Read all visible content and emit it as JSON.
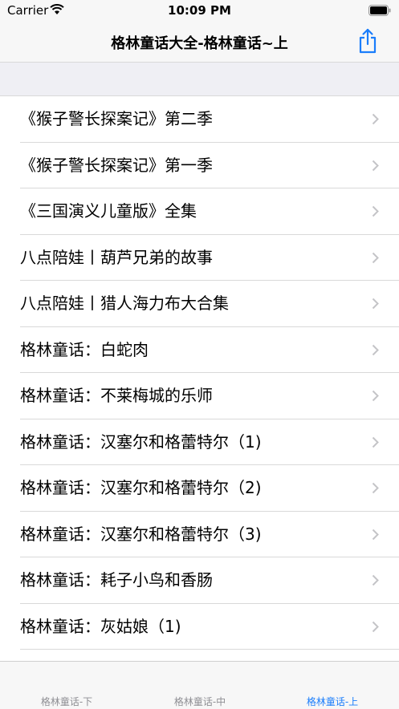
{
  "status": {
    "carrier": "Carrier",
    "time": "10:09 PM"
  },
  "nav": {
    "title": "格林童话大全-格林童话~上"
  },
  "items": [
    {
      "label": "《猴子警长探案记》第二季"
    },
    {
      "label": "《猴子警长探案记》第一季"
    },
    {
      "label": "《三国演义儿童版》全集"
    },
    {
      "label": "八点陪娃丨葫芦兄弟的故事"
    },
    {
      "label": "八点陪娃丨猎人海力布大合集"
    },
    {
      "label": "格林童话：白蛇肉"
    },
    {
      "label": "格林童话：不莱梅城的乐师"
    },
    {
      "label": "格林童话：汉塞尔和格蕾特尔（1)"
    },
    {
      "label": "格林童话：汉塞尔和格蕾特尔（2)"
    },
    {
      "label": "格林童话：汉塞尔和格蕾特尔（3)"
    },
    {
      "label": "格林童话：耗子小鸟和香肠"
    },
    {
      "label": "格林童话：灰姑娘（1)"
    }
  ],
  "tabs": [
    {
      "label": "格林童话-下"
    },
    {
      "label": "格林童话-中"
    },
    {
      "label": "格林童话-上"
    }
  ],
  "colors": {
    "accent": "#1a7dfb",
    "inactive_tab": "#8e8e93",
    "separator": "#d9d9d9"
  }
}
